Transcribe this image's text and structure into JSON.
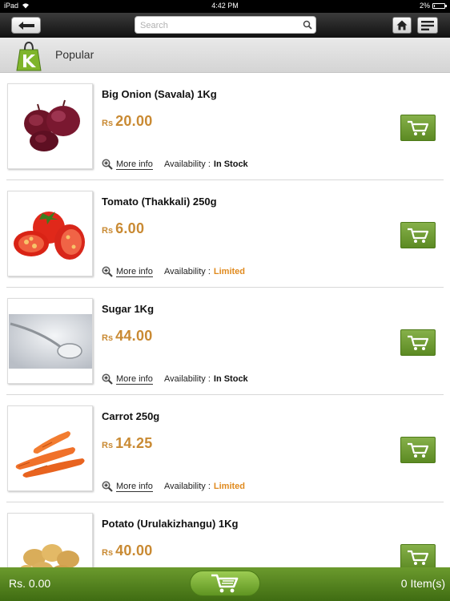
{
  "status_bar": {
    "device": "iPad",
    "time": "4:42 PM",
    "battery": "2%",
    "battery_level": 0.02
  },
  "search": {
    "placeholder": "Search",
    "value": ""
  },
  "category": {
    "title": "Popular"
  },
  "product_labels": {
    "more_info": "More info",
    "availability": "Availability :"
  },
  "products": [
    {
      "name": "Big Onion (Savala) 1Kg",
      "currency": "Rs",
      "price": "20.00",
      "stock": "In Stock",
      "image": "onion-image"
    },
    {
      "name": "Tomato (Thakkali) 250g",
      "currency": "Rs",
      "price": "6.00",
      "stock": "Limited",
      "image": "tomato-image"
    },
    {
      "name": "Sugar 1Kg",
      "currency": "Rs",
      "price": "44.00",
      "stock": "In Stock",
      "image": "sugar-image"
    },
    {
      "name": "Carrot 250g",
      "currency": "Rs",
      "price": "14.25",
      "stock": "Limited",
      "image": "carrot-image"
    },
    {
      "name": "Potato (Urulakizhangu) 1Kg",
      "currency": "Rs",
      "price": "40.00",
      "stock": "",
      "image": "potato-image"
    }
  ],
  "footer": {
    "total": "Rs. 0.00",
    "items": "0 Item(s)"
  },
  "colors": {
    "accent_green": "#6b9a2d",
    "price": "#c98a33",
    "limited": "#e08a1e",
    "in_stock": "#111111"
  }
}
